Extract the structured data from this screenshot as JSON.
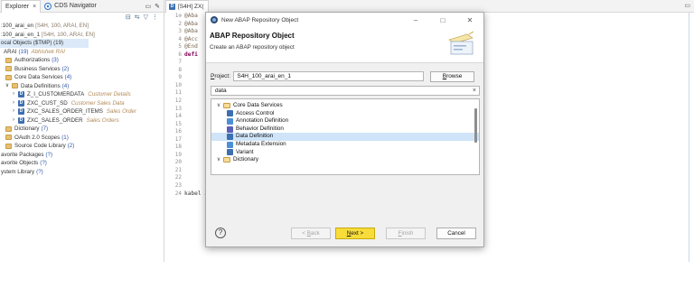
{
  "explorer": {
    "tabs": [
      {
        "label": "Explorer",
        "close": "×"
      },
      {
        "label": "CDS Navigator"
      }
    ],
    "tab_controls": [
      "▭",
      "✕"
    ],
    "toolbar_icons": [
      "collapse-all-icon",
      "link-with-editor-icon",
      "filter-icon",
      "view-menu-icon"
    ],
    "tree": [
      {
        "text": ":100_arai_en",
        "dim": "[S4H, 100, ARAI, EN]",
        "kind": "plain"
      },
      {
        "text": ":100_arai_en_1",
        "dim": "[S4H, 100, ARAI, EN]",
        "kind": "plain"
      },
      {
        "text": "ocal Objects ($TMP) (19)",
        "kind": "selected"
      },
      {
        "text": "ARAI",
        "count": "(19)",
        "arai": "Abhishek RAI",
        "kind": "plain"
      },
      {
        "text": "Authorizations",
        "count": "(3)",
        "kind": "folder"
      },
      {
        "text": "Business Services",
        "count": "(2)",
        "kind": "folder"
      },
      {
        "text": "Core Data Services",
        "count": "(4)",
        "kind": "folder"
      },
      {
        "text": "Data Definitions",
        "count": "(4)",
        "kind": "folder-open"
      },
      {
        "text": "Z_I_CUSTOMERDATA",
        "desc": "Customer Details",
        "kind": "ddl"
      },
      {
        "text": "ZXC_CUST_SD",
        "desc": "Customer Sales Data",
        "kind": "ddl"
      },
      {
        "text": "ZXC_SALES_ORDER_ITEMS",
        "desc": "Sales Order",
        "kind": "ddl"
      },
      {
        "text": "ZXC_SALES_ORDER",
        "desc": "Sales Orders",
        "kind": "ddl"
      },
      {
        "text": "Dictionary",
        "count": "(7)",
        "kind": "folder"
      },
      {
        "text": "OAuth 2.0 Scopes",
        "count": "(1)",
        "kind": "folder"
      },
      {
        "text": "Source Code Library",
        "count": "(2)",
        "kind": "folder"
      },
      {
        "text": "avorite Packages",
        "count": "(?)",
        "kind": "plain"
      },
      {
        "text": "avorite Objects",
        "count": "(?)",
        "kind": "plain"
      },
      {
        "text": "ystem Library",
        "count": "(?)",
        "kind": "plain"
      }
    ]
  },
  "editor": {
    "tab_label": "[S4H] ZX(",
    "maximize": "▭",
    "line_numbers": [
      "1⊕",
      "2",
      "3",
      "4",
      "5",
      "6",
      "7",
      "8",
      "9",
      "10",
      "11",
      "12",
      "13",
      "14",
      "15",
      "16",
      "17",
      "18",
      "19",
      "20",
      "21",
      "22",
      "23",
      "24"
    ],
    "code_lines": [
      "@Aba",
      "@Aba",
      "@Aba",
      "@Acc",
      "@End",
      "defi",
      "",
      "",
      "",
      "",
      "",
      "",
      "",
      "",
      "",
      "",
      "",
      "",
      "",
      "",
      "",
      "",
      "",
      "kabel as kabel;"
    ]
  },
  "dialog": {
    "title": "New ABAP Repository Object",
    "window_controls": [
      "–",
      "□",
      "✕"
    ],
    "header_title": "ABAP Repository Object",
    "header_subtitle": "Create an ABAP repository object",
    "project_label_prefix": "P",
    "project_label_rest": "roject:",
    "project_value": "S4H_100_arai_en_1",
    "browse_prefix": "B",
    "browse_rest": "rowse",
    "filter_value": "data",
    "filter_clear": "×",
    "tree": [
      {
        "label": "Core Data Services",
        "level": 0,
        "kind": "folder-open",
        "icon_color": "#f7dd9b"
      },
      {
        "label": "Access Control",
        "level": 1,
        "kind": "item",
        "icon_color": "#3d6fb1"
      },
      {
        "label": "Annotation Definition",
        "level": 1,
        "kind": "item",
        "icon_color": "#4d8fd6"
      },
      {
        "label": "Behavior Definition",
        "level": 1,
        "kind": "item",
        "icon_color": "#5a5fb8"
      },
      {
        "label": "Data Definition",
        "level": 1,
        "kind": "item",
        "icon_color": "#3d6fb1",
        "selected": true
      },
      {
        "label": "Metadata Extension",
        "level": 1,
        "kind": "item",
        "icon_color": "#4d8fd6"
      },
      {
        "label": "Variant",
        "level": 1,
        "kind": "item",
        "icon_color": "#3d6fb1"
      },
      {
        "label": "Dictionary",
        "level": 0,
        "kind": "folder-open",
        "icon_color": "#f7dd9b"
      }
    ],
    "footer": {
      "help": "?",
      "back_prefix": "< ",
      "back_u": "B",
      "back_rest": "ack",
      "next_u": "N",
      "next_rest": "ext >",
      "finish_u": "F",
      "finish_rest": "inish",
      "cancel": "Cancel"
    }
  },
  "colors": {
    "primary_button": "#f7dc3a",
    "selection": "#cfe4f9",
    "folder": "#e8c071",
    "ddl_icon": "#3d6fb1"
  }
}
